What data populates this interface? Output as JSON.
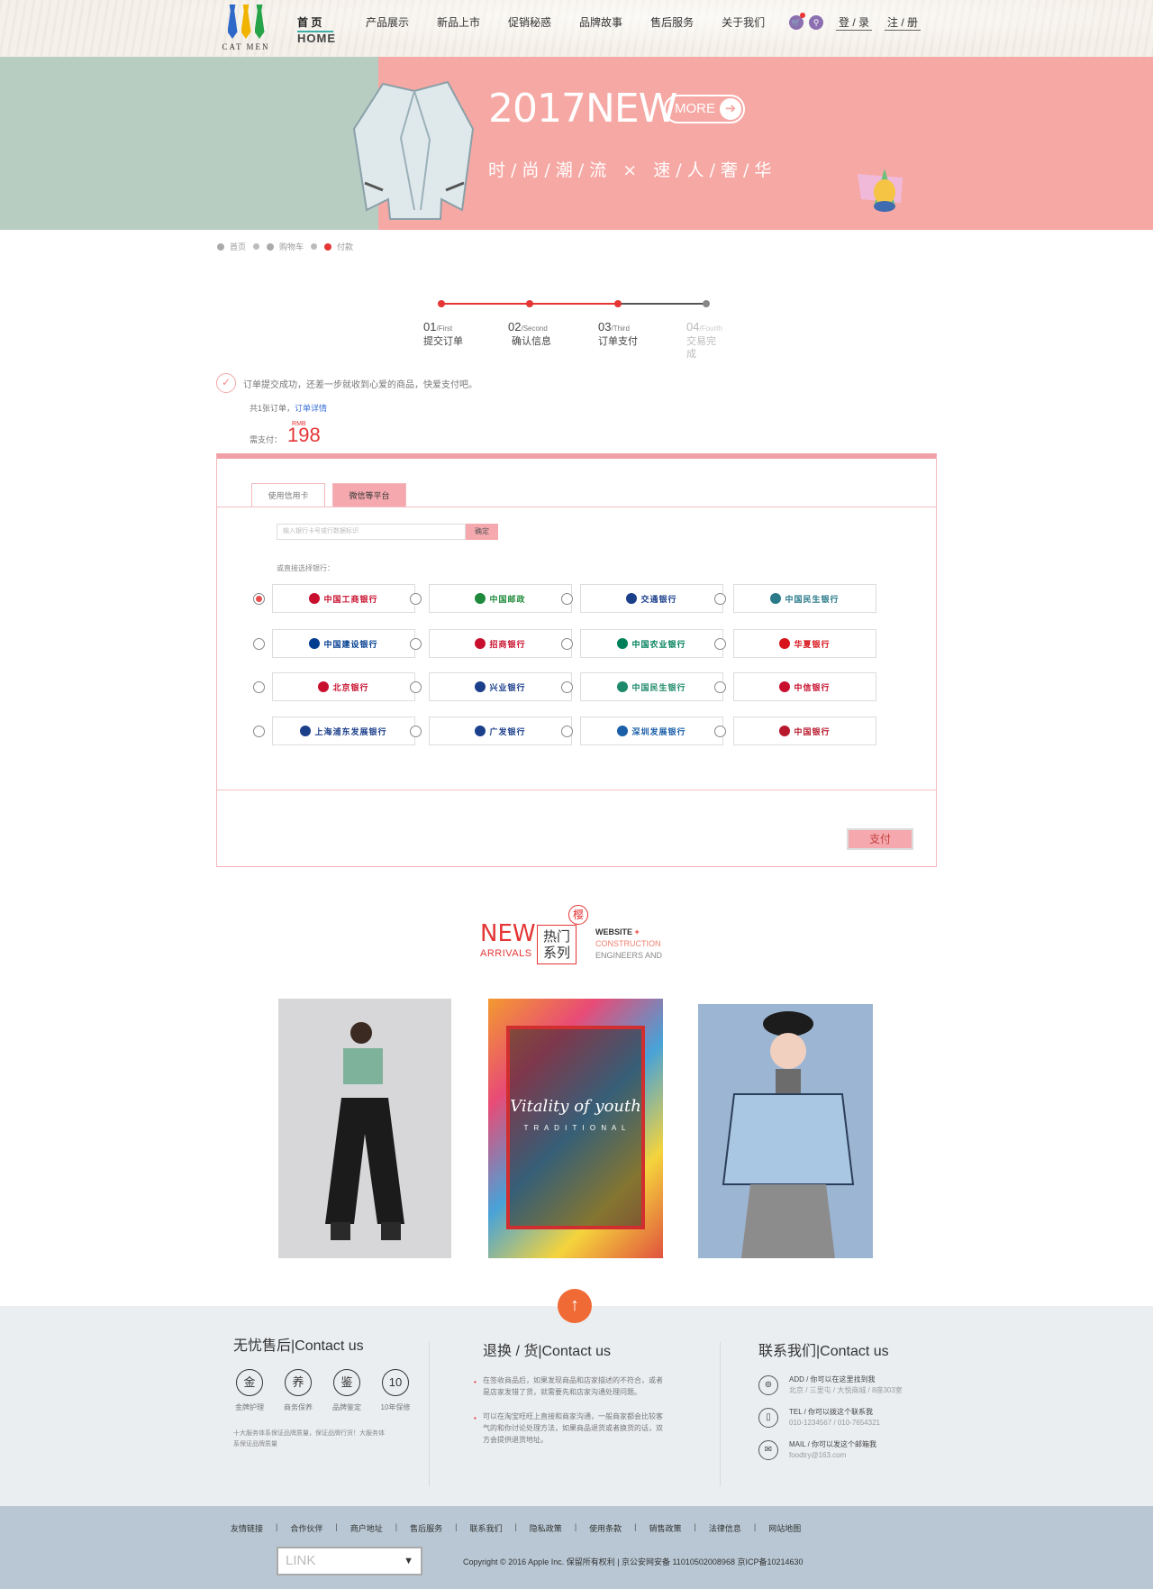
{
  "header": {
    "brand": "CAT MEN",
    "nav": [
      {
        "label": "首 页",
        "sub": "HOME",
        "active": true
      },
      {
        "label": "产品展示"
      },
      {
        "label": "新品上市"
      },
      {
        "label": "促销秘惑"
      },
      {
        "label": "品牌故事"
      },
      {
        "label": "售后服务"
      },
      {
        "label": "关于我们"
      }
    ],
    "login": "登 / 录",
    "register": "注 / 册"
  },
  "banner": {
    "title": "2017NEW",
    "more": "MORE",
    "slogan": "时/尚/潮/流 × 速/人/奢/华"
  },
  "breadcrumb": [
    "首页",
    "购物车",
    "付款"
  ],
  "steps": [
    {
      "num": "01",
      "en": "/First",
      "cn": "提交订单"
    },
    {
      "num": "02",
      "en": "/Second",
      "cn": "确认信息"
    },
    {
      "num": "03",
      "en": "/Third",
      "cn": "订单支付"
    },
    {
      "num": "04",
      "en": "/Fourth",
      "cn": "交易完成"
    }
  ],
  "order": {
    "success_msg": "订单提交成功，还差一步就收到心爱的商品，快爱支付吧。",
    "order_label": "共1张订单，",
    "order_link": "订单详情",
    "pay_label": "需支付：",
    "currency": "RMB",
    "amount": "198"
  },
  "payment": {
    "tabs": [
      "使用信用卡",
      "微信等平台"
    ],
    "card_placeholder": "输入银行卡号或行数据标识",
    "confirm": "确定",
    "bank_prompt": "或直接选择银行：",
    "banks": [
      {
        "name": "中国工商银行",
        "color": "#c8102e"
      },
      {
        "name": "中国邮政",
        "color": "#1f8a3b"
      },
      {
        "name": "交通银行",
        "color": "#1b3f8b"
      },
      {
        "name": "中国民生银行",
        "color": "#2a7a8a"
      },
      {
        "name": "中国建设银行",
        "color": "#003d8f"
      },
      {
        "name": "招商银行",
        "color": "#c8102e"
      },
      {
        "name": "中国农业银行",
        "color": "#00805a"
      },
      {
        "name": "华夏银行",
        "color": "#d7141a"
      },
      {
        "name": "北京银行",
        "color": "#c8102e"
      },
      {
        "name": "兴业银行",
        "color": "#1b3f8b"
      },
      {
        "name": "中国民生银行",
        "color": "#1f8a6b"
      },
      {
        "name": "中信银行",
        "color": "#c8102e"
      },
      {
        "name": "上海浦东发展银行",
        "color": "#1b3f8b"
      },
      {
        "name": "广发银行",
        "color": "#1b3f8b"
      },
      {
        "name": "深圳发展银行",
        "color": "#1b5fa8"
      },
      {
        "name": "中国银行",
        "color": "#b8192c"
      }
    ],
    "selected_bank_index": 0,
    "pay_button": "支付"
  },
  "arrivals": {
    "new": "NEW",
    "sub": "ARRIVALS",
    "box": "热门系列",
    "seal": "樱",
    "eng1": "WEBSITE",
    "eng2": "CONSTRUCTION",
    "eng3": "ENGINEERS AND",
    "poster_title": "Vitality of youth",
    "poster_sub": "T R A D I T I O N A L"
  },
  "footer": {
    "col1_title": "无忧售后|Contact us",
    "badges": [
      {
        "glyph": "金",
        "label": "金牌护理"
      },
      {
        "glyph": "养",
        "label": "商务保养"
      },
      {
        "glyph": "鉴",
        "label": "品牌鉴定"
      },
      {
        "glyph": "10",
        "label": "10年保修"
      }
    ],
    "col1_note": "十大服务体系保证品牌质量，保证品牌行货！大服务体系保证品牌质量",
    "col2_title": "退换 / 货|Contact us",
    "col2_bullets": [
      "在签收商品后，如果发现商品和店家描述的不符合，或者是店家发错了货，就需要先和店家沟通处理问题。",
      "可以在淘宝旺旺上直接和商家沟通，一般商家都会比较客气的和你讨论处理方法，如果商品退货或者换货的话，双方会提供退货地址。"
    ],
    "col3_title": "联系我们|Contact us",
    "contacts": [
      {
        "icon": "⊚",
        "title": "ADD / 你可以在这里找到我",
        "sub": "北京 / 三里屯 / 大悦商城 / 8座303室"
      },
      {
        "icon": "▯",
        "title": "TEL / 你可以拨这个联系我",
        "sub": "010-1234567  /  010-7654321"
      },
      {
        "icon": "✉",
        "title": "MAIL / 你可以发这个邮箱我",
        "sub": "foodtry@163.com"
      }
    ]
  },
  "bottom": {
    "links": [
      "友情链接",
      "合作伙伴",
      "商户地址",
      "售后服务",
      "联系我们",
      "隐私政策",
      "使用条款",
      "销售政策",
      "法律信息",
      "网站地图"
    ],
    "select": "LINK",
    "copyright": "Copyright © 2016 Apple Inc. 保留所有权利 | 京公安网安备 11010502008968 京ICP备10214630"
  }
}
